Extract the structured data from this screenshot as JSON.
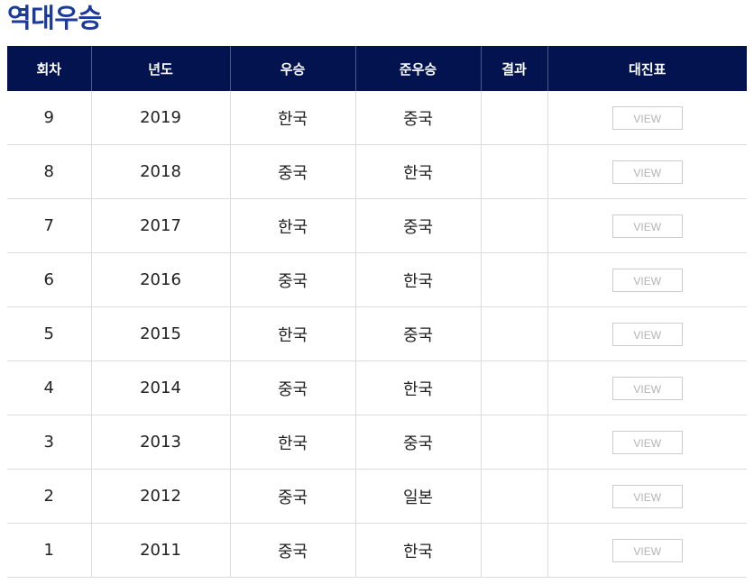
{
  "title": "역대우승",
  "columns": [
    "회차",
    "년도",
    "우승",
    "준우승",
    "결과",
    "대진표"
  ],
  "rows": [
    {
      "round": "9",
      "year": "2019",
      "winner": "한국",
      "runner_up": "중국",
      "result": "",
      "bracket": "VIEW"
    },
    {
      "round": "8",
      "year": "2018",
      "winner": "중국",
      "runner_up": "한국",
      "result": "",
      "bracket": "VIEW"
    },
    {
      "round": "7",
      "year": "2017",
      "winner": "한국",
      "runner_up": "중국",
      "result": "",
      "bracket": "VIEW"
    },
    {
      "round": "6",
      "year": "2016",
      "winner": "중국",
      "runner_up": "한국",
      "result": "",
      "bracket": "VIEW"
    },
    {
      "round": "5",
      "year": "2015",
      "winner": "한국",
      "runner_up": "중국",
      "result": "",
      "bracket": "VIEW"
    },
    {
      "round": "4",
      "year": "2014",
      "winner": "중국",
      "runner_up": "한국",
      "result": "",
      "bracket": "VIEW"
    },
    {
      "round": "3",
      "year": "2013",
      "winner": "한국",
      "runner_up": "중국",
      "result": "",
      "bracket": "VIEW"
    },
    {
      "round": "2",
      "year": "2012",
      "winner": "중국",
      "runner_up": "일본",
      "result": "",
      "bracket": "VIEW"
    },
    {
      "round": "1",
      "year": "2011",
      "winner": "중국",
      "runner_up": "한국",
      "result": "",
      "bracket": "VIEW"
    }
  ],
  "colors": {
    "title": "#1c3a9e",
    "header_bg": "#02134f",
    "header_text": "#ffffff",
    "border": "#dcdcdc",
    "view_text": "#b3b3b3"
  }
}
